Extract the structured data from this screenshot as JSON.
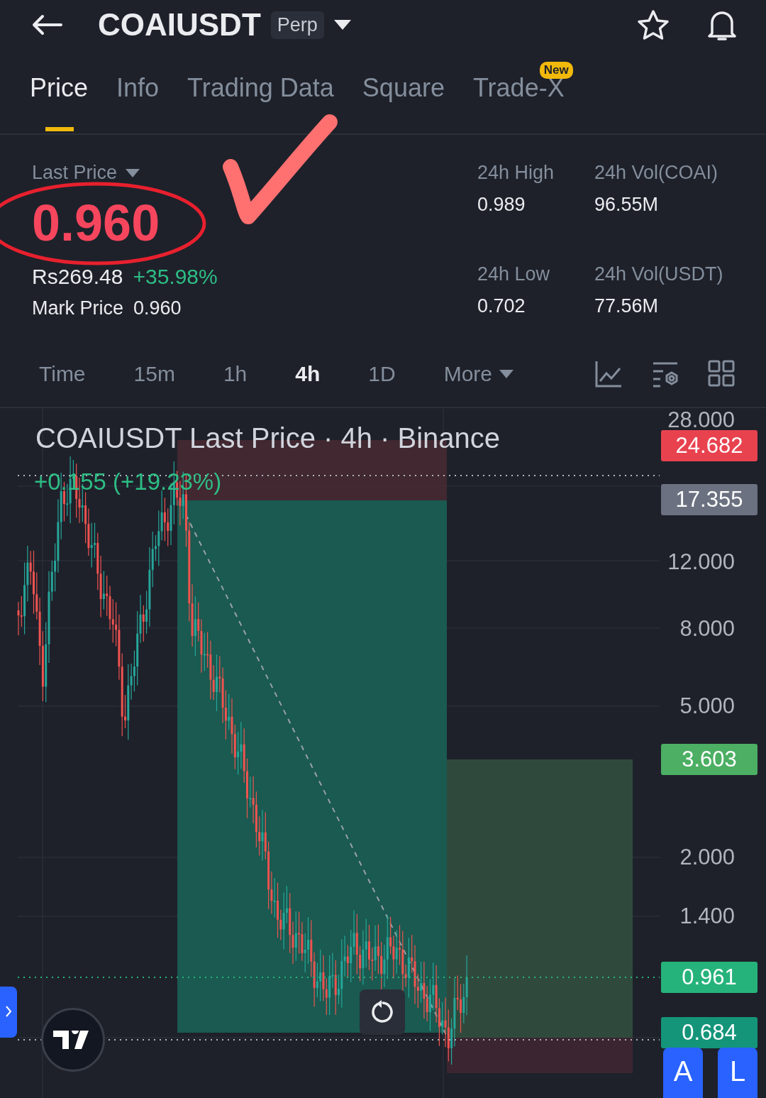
{
  "header": {
    "symbol": "COAIUSDT",
    "badge": "Perp"
  },
  "tabs": [
    {
      "label": "Price",
      "selected": true
    },
    {
      "label": "Info",
      "selected": false
    },
    {
      "label": "Trading Data",
      "selected": false
    },
    {
      "label": "Square",
      "selected": false
    },
    {
      "label": "Trade-X",
      "selected": false,
      "badge": "New"
    }
  ],
  "ticker": {
    "label": "Last Price",
    "price": "0.960",
    "fiat": "Rs269.48",
    "change": "+35.98%",
    "mark_label": "Mark Price",
    "mark_price": "0.960"
  },
  "stats": [
    {
      "label": "24h High",
      "value": "0.989"
    },
    {
      "label": "24h Vol(COAI)",
      "value": "96.55M"
    },
    {
      "label": "24h Low",
      "value": "0.702"
    },
    {
      "label": "24h Vol(USDT)",
      "value": "77.56M"
    }
  ],
  "intervals": [
    {
      "label": "Time",
      "selected": false,
      "kind": "text"
    },
    {
      "label": "15m",
      "selected": false,
      "kind": "text"
    },
    {
      "label": "1h",
      "selected": false,
      "kind": "text"
    },
    {
      "label": "4h",
      "selected": true,
      "kind": "text"
    },
    {
      "label": "1D",
      "selected": false,
      "kind": "text"
    },
    {
      "label": "More",
      "selected": false,
      "kind": "dropdown"
    }
  ],
  "chart": {
    "title": "COAIUSDT Last Price · 4h · Binance",
    "change": "+0.155 (+19.23%)",
    "axis_labels": [
      "28.000",
      "12.000",
      "8.000",
      "5.000",
      "2.000",
      "1.400"
    ],
    "price_tags": [
      {
        "value": "24.682",
        "color": "#e8424f"
      },
      {
        "value": "17.355",
        "color": "#6b7180"
      },
      {
        "value": "3.603",
        "color": "#4caf63"
      },
      {
        "value": "0.961",
        "color": "#26b37b"
      },
      {
        "value": "0.684",
        "color": "#14957a"
      }
    ]
  },
  "corner_buttons": [
    "A",
    "L"
  ]
}
